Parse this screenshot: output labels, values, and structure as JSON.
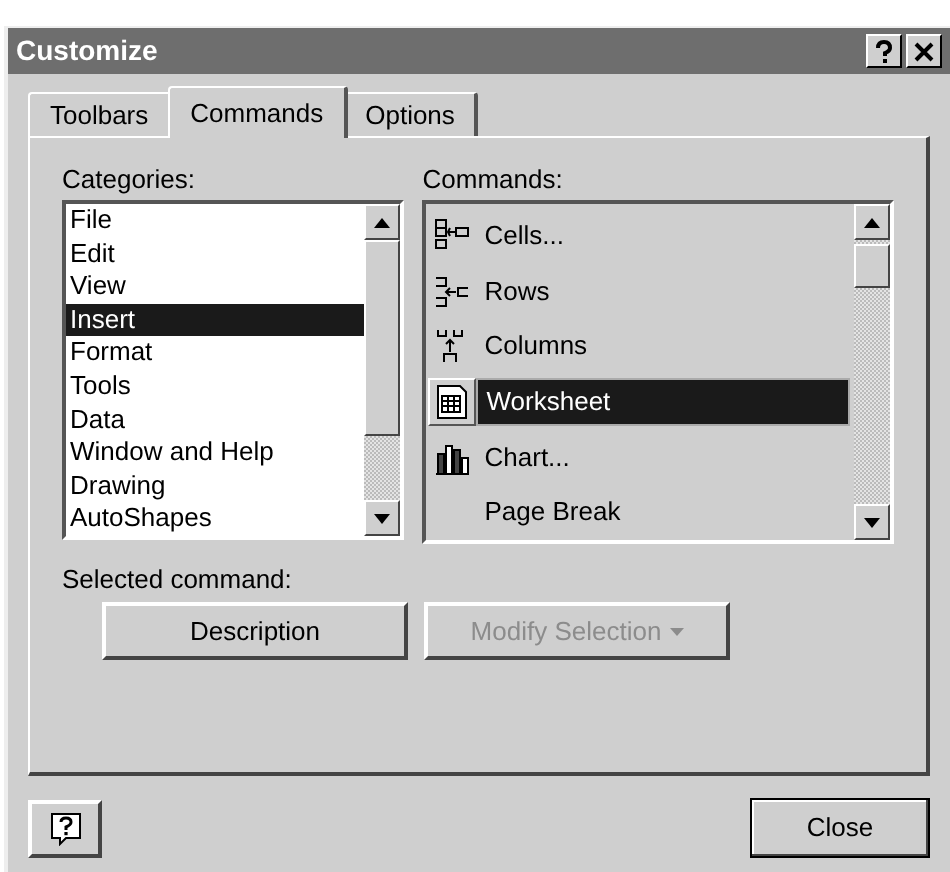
{
  "window": {
    "title": "Customize"
  },
  "tabs": [
    {
      "label": "Toolbars",
      "selected": false
    },
    {
      "label": "Commands",
      "selected": true
    },
    {
      "label": "Options",
      "selected": false
    }
  ],
  "categories": {
    "label": "Categories:",
    "items": [
      {
        "label": "File",
        "selected": false
      },
      {
        "label": "Edit",
        "selected": false
      },
      {
        "label": "View",
        "selected": false
      },
      {
        "label": "Insert",
        "selected": true
      },
      {
        "label": "Format",
        "selected": false
      },
      {
        "label": "Tools",
        "selected": false
      },
      {
        "label": "Data",
        "selected": false
      },
      {
        "label": "Window and Help",
        "selected": false
      },
      {
        "label": "Drawing",
        "selected": false
      },
      {
        "label": "AutoShapes",
        "selected": false
      }
    ]
  },
  "commands": {
    "label": "Commands:",
    "items": [
      {
        "label": "Cells...",
        "kind": "cells",
        "selected": false
      },
      {
        "label": "Rows",
        "kind": "rows",
        "selected": false
      },
      {
        "label": "Columns",
        "kind": "columns",
        "selected": false
      },
      {
        "label": "Worksheet",
        "kind": "worksheet",
        "selected": true
      },
      {
        "label": "Chart...",
        "kind": "chart",
        "selected": false
      },
      {
        "label": "Page Break",
        "kind": "plain",
        "selected": false
      }
    ]
  },
  "selected_command": {
    "label": "Selected command:",
    "buttons": [
      {
        "label": "Description",
        "disabled": false,
        "dropdown": false
      },
      {
        "label": "Modify Selection",
        "disabled": true,
        "dropdown": true
      }
    ]
  },
  "footer": {
    "close": "Close"
  }
}
